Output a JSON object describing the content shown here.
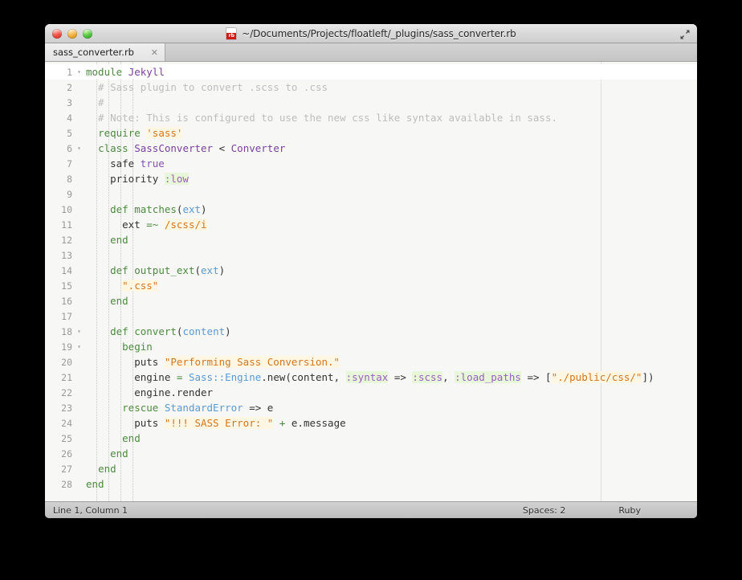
{
  "window": {
    "title": "~/Documents/Projects/floatleft/_plugins/sass_converter.rb",
    "file_icon": "ruby-file-icon",
    "traffic_lights": {
      "close_label": "close",
      "minimize_label": "minimize",
      "maximize_label": "maximize"
    },
    "fullscreen_icon": "fullscreen-arrows-icon"
  },
  "tabs": [
    {
      "label": "sass_converter.rb",
      "close_glyph": "✕",
      "active": true
    }
  ],
  "editor": {
    "lines": [
      {
        "num": "1",
        "fold": "▾",
        "current": true,
        "tokens": [
          {
            "t": "module ",
            "c": "t-kw"
          },
          {
            "t": "Jekyll",
            "c": "t-class"
          }
        ]
      },
      {
        "num": "2",
        "fold": "",
        "current": false,
        "tokens": [
          {
            "t": "  # Sass plugin to convert .scss to .css",
            "c": "t-comment"
          }
        ]
      },
      {
        "num": "3",
        "fold": "",
        "current": false,
        "tokens": [
          {
            "t": "  #",
            "c": "t-comment"
          }
        ]
      },
      {
        "num": "4",
        "fold": "",
        "current": false,
        "tokens": [
          {
            "t": "  # Note: This is configured to use the new css like syntax available in sass.",
            "c": "t-comment"
          }
        ]
      },
      {
        "num": "5",
        "fold": "",
        "current": false,
        "tokens": [
          {
            "t": "  ",
            "c": "t-plain"
          },
          {
            "t": "require",
            "c": "t-kw"
          },
          {
            "t": " ",
            "c": "t-plain"
          },
          {
            "t": "'sass'",
            "c": "t-str"
          }
        ]
      },
      {
        "num": "6",
        "fold": "▾",
        "current": false,
        "tokens": [
          {
            "t": "  ",
            "c": "t-plain"
          },
          {
            "t": "class",
            "c": "t-kw"
          },
          {
            "t": " ",
            "c": "t-plain"
          },
          {
            "t": "SassConverter",
            "c": "t-class"
          },
          {
            "t": " < ",
            "c": "t-plain"
          },
          {
            "t": "Converter",
            "c": "t-class"
          }
        ]
      },
      {
        "num": "7",
        "fold": "",
        "current": false,
        "tokens": [
          {
            "t": "    safe ",
            "c": "t-plain"
          },
          {
            "t": "true",
            "c": "t-bool"
          }
        ]
      },
      {
        "num": "8",
        "fold": "",
        "current": false,
        "tokens": [
          {
            "t": "    priority ",
            "c": "t-plain"
          },
          {
            "t": ":low",
            "c": "t-sym"
          }
        ]
      },
      {
        "num": "9",
        "fold": "",
        "current": false,
        "tokens": []
      },
      {
        "num": "10",
        "fold": "",
        "current": false,
        "tokens": [
          {
            "t": "    ",
            "c": "t-plain"
          },
          {
            "t": "def",
            "c": "t-kw"
          },
          {
            "t": " ",
            "c": "t-plain"
          },
          {
            "t": "matches",
            "c": "t-kw"
          },
          {
            "t": "(",
            "c": "t-plain"
          },
          {
            "t": "ext",
            "c": "t-param"
          },
          {
            "t": ")",
            "c": "t-plain"
          }
        ]
      },
      {
        "num": "11",
        "fold": "",
        "current": false,
        "tokens": [
          {
            "t": "      ext ",
            "c": "t-plain"
          },
          {
            "t": "=~",
            "c": "t-op"
          },
          {
            "t": " ",
            "c": "t-plain"
          },
          {
            "t": "/scss/i",
            "c": "t-regex"
          }
        ]
      },
      {
        "num": "12",
        "fold": "",
        "current": false,
        "tokens": [
          {
            "t": "    ",
            "c": "t-plain"
          },
          {
            "t": "end",
            "c": "t-kw"
          }
        ]
      },
      {
        "num": "13",
        "fold": "",
        "current": false,
        "tokens": []
      },
      {
        "num": "14",
        "fold": "",
        "current": false,
        "tokens": [
          {
            "t": "    ",
            "c": "t-plain"
          },
          {
            "t": "def",
            "c": "t-kw"
          },
          {
            "t": " ",
            "c": "t-plain"
          },
          {
            "t": "output_ext",
            "c": "t-kw"
          },
          {
            "t": "(",
            "c": "t-plain"
          },
          {
            "t": "ext",
            "c": "t-param"
          },
          {
            "t": ")",
            "c": "t-plain"
          }
        ]
      },
      {
        "num": "15",
        "fold": "",
        "current": false,
        "tokens": [
          {
            "t": "      ",
            "c": "t-plain"
          },
          {
            "t": "\".css\"",
            "c": "t-str"
          }
        ]
      },
      {
        "num": "16",
        "fold": "",
        "current": false,
        "tokens": [
          {
            "t": "    ",
            "c": "t-plain"
          },
          {
            "t": "end",
            "c": "t-kw"
          }
        ]
      },
      {
        "num": "17",
        "fold": "",
        "current": false,
        "tokens": []
      },
      {
        "num": "18",
        "fold": "▾",
        "current": false,
        "tokens": [
          {
            "t": "    ",
            "c": "t-plain"
          },
          {
            "t": "def",
            "c": "t-kw"
          },
          {
            "t": " ",
            "c": "t-plain"
          },
          {
            "t": "convert",
            "c": "t-kw"
          },
          {
            "t": "(",
            "c": "t-plain"
          },
          {
            "t": "content",
            "c": "t-param"
          },
          {
            "t": ")",
            "c": "t-plain"
          }
        ]
      },
      {
        "num": "19",
        "fold": "▾",
        "current": false,
        "tokens": [
          {
            "t": "      ",
            "c": "t-plain"
          },
          {
            "t": "begin",
            "c": "t-kw"
          }
        ]
      },
      {
        "num": "20",
        "fold": "",
        "current": false,
        "tokens": [
          {
            "t": "        puts ",
            "c": "t-plain"
          },
          {
            "t": "\"Performing Sass Conversion.\"",
            "c": "t-str"
          }
        ]
      },
      {
        "num": "21",
        "fold": "",
        "current": false,
        "tokens": [
          {
            "t": "        engine ",
            "c": "t-plain"
          },
          {
            "t": "=",
            "c": "t-op"
          },
          {
            "t": " ",
            "c": "t-plain"
          },
          {
            "t": "Sass::Engine",
            "c": "t-const"
          },
          {
            "t": ".new(content, ",
            "c": "t-plain"
          },
          {
            "t": ":syntax",
            "c": "t-sym"
          },
          {
            "t": " => ",
            "c": "t-plain"
          },
          {
            "t": ":scss",
            "c": "t-sym"
          },
          {
            "t": ", ",
            "c": "t-plain"
          },
          {
            "t": ":load_paths",
            "c": "t-sym"
          },
          {
            "t": " => [",
            "c": "t-plain"
          },
          {
            "t": "\"./public/css/\"",
            "c": "t-str"
          },
          {
            "t": "])",
            "c": "t-plain"
          }
        ]
      },
      {
        "num": "22",
        "fold": "",
        "current": false,
        "tokens": [
          {
            "t": "        engine.render",
            "c": "t-plain"
          }
        ]
      },
      {
        "num": "23",
        "fold": "",
        "current": false,
        "tokens": [
          {
            "t": "      ",
            "c": "t-plain"
          },
          {
            "t": "rescue",
            "c": "t-kw"
          },
          {
            "t": " ",
            "c": "t-plain"
          },
          {
            "t": "StandardError",
            "c": "t-const"
          },
          {
            "t": " => e",
            "c": "t-plain"
          }
        ]
      },
      {
        "num": "24",
        "fold": "",
        "current": false,
        "tokens": [
          {
            "t": "        puts ",
            "c": "t-plain"
          },
          {
            "t": "\"!!! SASS Error: \"",
            "c": "t-str"
          },
          {
            "t": " ",
            "c": "t-plain"
          },
          {
            "t": "+",
            "c": "t-op"
          },
          {
            "t": " e.message",
            "c": "t-plain"
          }
        ]
      },
      {
        "num": "25",
        "fold": "",
        "current": false,
        "tokens": [
          {
            "t": "      ",
            "c": "t-plain"
          },
          {
            "t": "end",
            "c": "t-kw"
          }
        ]
      },
      {
        "num": "26",
        "fold": "",
        "current": false,
        "tokens": [
          {
            "t": "    ",
            "c": "t-plain"
          },
          {
            "t": "end",
            "c": "t-kw"
          }
        ]
      },
      {
        "num": "27",
        "fold": "",
        "current": false,
        "tokens": [
          {
            "t": "  ",
            "c": "t-plain"
          },
          {
            "t": "end",
            "c": "t-kw"
          }
        ]
      },
      {
        "num": "28",
        "fold": "",
        "current": false,
        "tokens": [
          {
            "t": "end",
            "c": "t-kw"
          }
        ]
      }
    ],
    "indent_guide_columns": [
      1,
      2,
      3,
      4
    ],
    "ruler_column": 80
  },
  "statusbar": {
    "caret": "Line 1, Column 1",
    "spaces": "Spaces: 2",
    "syntax": "Ruby"
  },
  "colors": {
    "background": "#f7f7f5",
    "current_line": "#ffffff",
    "keyword": "#4c8a3f",
    "class": "#7b3fa0",
    "constant": "#5a9ad4",
    "string": "#d4761f",
    "string_bg": "#fdf6e3",
    "symbol": "#9a5fc2",
    "symbol_bg": "#e8f7d9",
    "comment": "#bdbdbd",
    "plain": "#333333",
    "gutter": "#9a9a9a"
  }
}
